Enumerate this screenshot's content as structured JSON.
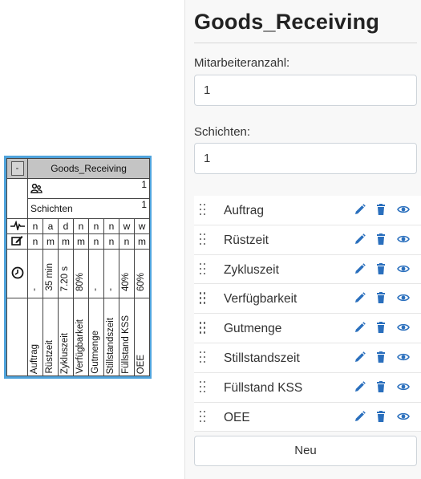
{
  "process_box": {
    "collapse_label": "-",
    "title": "Goods_Receiving",
    "workers_icon": "people-icon",
    "workers_value": "1",
    "shifts_label": "Schichten",
    "shifts_value": "1",
    "row_icons": [
      "pulse-icon",
      "edit-note-icon",
      "clock-icon"
    ],
    "columns": [
      {
        "r1": "n",
        "r2": "n",
        "value": "-",
        "label": "Auftrag"
      },
      {
        "r1": "a",
        "r2": "m",
        "value": "35 min",
        "label": "Rüstzeit"
      },
      {
        "r1": "d",
        "r2": "m",
        "value": "7.20 s",
        "label": "Zykluszeit"
      },
      {
        "r1": "n",
        "r2": "m",
        "value": "80%",
        "label": "Verfügbarkeit"
      },
      {
        "r1": "n",
        "r2": "n",
        "value": "-",
        "label": "Gutmenge"
      },
      {
        "r1": "n",
        "r2": "n",
        "value": "-",
        "label": "Stillstandszeit"
      },
      {
        "r1": "w",
        "r2": "n",
        "value": "40%",
        "label": "Füllstand KSS"
      },
      {
        "r1": "w",
        "r2": "m",
        "value": "60%",
        "label": "OEE"
      }
    ]
  },
  "panel": {
    "title": "Goods_Receiving",
    "workers_label": "Mitarbeiteranzahl:",
    "workers_value": "1",
    "shifts_label": "Schichten:",
    "shifts_value": "1",
    "attributes": [
      "Auftrag",
      "Rüstzeit",
      "Zykluszeit",
      "Verfügbarkeit",
      "Gutmenge",
      "Stillstandszeit",
      "Füllstand KSS",
      "OEE"
    ],
    "new_button": "Neu",
    "accent_color": "#2a6fbd"
  }
}
